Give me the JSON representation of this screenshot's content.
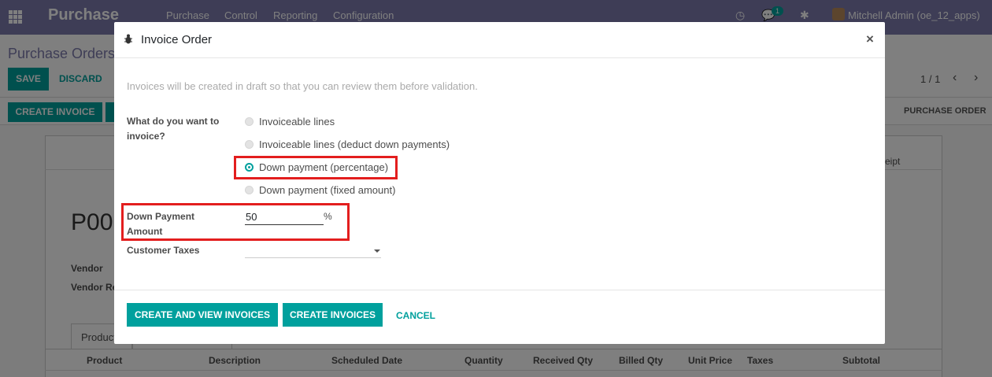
{
  "navbar": {
    "app_title": "Purchase",
    "menus": [
      "Purchase",
      "Control",
      "Reporting",
      "Configuration"
    ],
    "message_count": "1",
    "user": "Mitchell Admin (oe_12_apps)"
  },
  "form": {
    "breadcrumb": "Purchase Orders",
    "save_label": "SAVE",
    "discard_label": "DISCARD",
    "pager": "1 / 1",
    "create_invoice_label": "CREATE INVOICE",
    "status_purchase_order": "PURCHASE ORDER",
    "receipt_label": "eipt",
    "po_name": "P00",
    "vendor_label": "Vendor",
    "vendor_ref_label": "Vendor Re",
    "tab_products": "Product",
    "columns": [
      "Product",
      "Description",
      "Scheduled Date",
      "Quantity",
      "Received Qty",
      "Billed Qty",
      "Unit Price",
      "Taxes",
      "Subtotal"
    ]
  },
  "dialog": {
    "title": "Invoice Order",
    "intro": "Invoices will be created in draft so that you can review them before validation.",
    "question_label": "What do you want to invoice?",
    "options": [
      {
        "label": "Invoiceable lines",
        "checked": false
      },
      {
        "label": "Invoiceable lines (deduct down payments)",
        "checked": false
      },
      {
        "label": "Down payment (percentage)",
        "checked": true
      },
      {
        "label": "Down payment (fixed amount)",
        "checked": false
      }
    ],
    "amount_label": "Down Payment Amount",
    "amount_value": "50",
    "amount_unit": "%",
    "taxes_label": "Customer Taxes",
    "buttons": {
      "create_view": "CREATE AND VIEW INVOICES",
      "create": "CREATE INVOICES",
      "cancel": "CANCEL"
    }
  },
  "colors": {
    "navbar": "#7c7bad",
    "primary": "#00a09d",
    "highlight": "#e31e1e"
  }
}
